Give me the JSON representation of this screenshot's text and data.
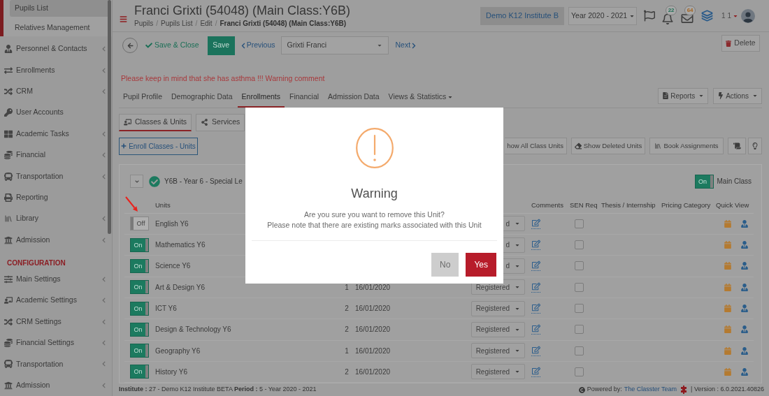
{
  "sidebar": {
    "subitems": [
      {
        "label": "Pupils List",
        "selected": true
      },
      {
        "label": "Relatives Management",
        "selected": false
      }
    ],
    "items": [
      {
        "label": "Personnel & Contacts",
        "expandable": true
      },
      {
        "label": "Enrollments",
        "expandable": true
      },
      {
        "label": "CRM",
        "expandable": true
      },
      {
        "label": "User Accounts",
        "expandable": false
      },
      {
        "label": "Academic Tasks",
        "expandable": true
      },
      {
        "label": "Financial",
        "expandable": true
      },
      {
        "label": "Transportation",
        "expandable": true
      },
      {
        "label": "Reporting",
        "expandable": false
      },
      {
        "label": "Library",
        "expandable": true
      },
      {
        "label": "Admission",
        "expandable": true
      }
    ],
    "section_title": "CONFIGURATION",
    "config_items": [
      {
        "label": "Main Settings",
        "expandable": true
      },
      {
        "label": "Academic Settings",
        "expandable": true
      },
      {
        "label": "CRM Settings",
        "expandable": true
      },
      {
        "label": "Financial Settings",
        "expandable": true
      },
      {
        "label": "Transportation",
        "expandable": true
      },
      {
        "label": "Admission",
        "expandable": true
      }
    ]
  },
  "header": {
    "title": "Franci Grixti (54048) (Main Class:Y6B)",
    "breadcrumb": [
      {
        "label": "Pupils",
        "separator": "/",
        "current": false
      },
      {
        "label": "Pupils List",
        "separator": "/",
        "current": false
      },
      {
        "label": "Edit",
        "separator": "/",
        "current": false
      },
      {
        "label": "Franci Grixti (54048) (Main Class:Y6B)",
        "current": true
      }
    ],
    "institute": "Demo K12 Institute B",
    "year": "Year 2020 - 2021",
    "notifications": "22",
    "messages": "64",
    "user": "1 1"
  },
  "toolbar": {
    "save_close": "Save & Close",
    "save": "Save",
    "previous": "Previous",
    "pupil": "Grixti Franci",
    "next": "Next",
    "delete": "Delete"
  },
  "warning_comment": "Please keep in mind that she has asthma !!! Warning comment",
  "tabs": [
    {
      "label": "Pupil Profile",
      "selected": false,
      "menu": false
    },
    {
      "label": "Demographic Data",
      "selected": false,
      "menu": false
    },
    {
      "label": "Enrollments",
      "selected": true,
      "menu": false
    },
    {
      "label": "Financial",
      "selected": false,
      "menu": false
    },
    {
      "label": "Admission Data",
      "selected": false,
      "menu": false
    },
    {
      "label": "Views & Statistics",
      "selected": false,
      "menu": true
    }
  ],
  "tab_actions": [
    "Reports",
    "Actions"
  ],
  "subtabs": [
    {
      "label": "Classes & Units",
      "selected": true
    },
    {
      "label": "Services",
      "selected": false
    }
  ],
  "unit_actions": {
    "enroll": "Enroll Classes - Units",
    "buttons": [
      "how All Class Units",
      "Show Deleted Units",
      "Book Assignments"
    ]
  },
  "class_group": {
    "title": "Y6B - Year 6 - Special Le",
    "expanded": true,
    "main_class": {
      "switch_label": "On",
      "on": true,
      "label": "Main Class"
    }
  },
  "table": {
    "columns": [
      "Units",
      "Comments",
      "SEN Req",
      "Thesis / Internship",
      "Pricing Category",
      "Quick View"
    ],
    "rows": [
      {
        "switch_label": "Off",
        "on": false,
        "unit": "English Y6",
        "column_5": "d",
        "sen_req": false
      },
      {
        "switch_label": "On",
        "on": true,
        "unit": "Mathematics Y6",
        "column_5": "d",
        "sen_req": false
      },
      {
        "switch_label": "On",
        "on": true,
        "unit": "Science Y6",
        "column_5": "d",
        "sen_req": false
      },
      {
        "switch_label": "On",
        "on": true,
        "unit": "Art & Design Y6",
        "column_3": "1",
        "column_4": "16/01/2020",
        "column_5": "Registered",
        "sen_req": false
      },
      {
        "switch_label": "On",
        "on": true,
        "unit": "ICT Y6",
        "column_3": "2",
        "column_4": "16/01/2020",
        "column_5": "Registered",
        "sen_req": false
      },
      {
        "switch_label": "On",
        "on": true,
        "unit": "Design & Technology Y6",
        "column_3": "2",
        "column_4": "16/01/2020",
        "column_5": "Registered",
        "sen_req": false
      },
      {
        "switch_label": "On",
        "on": true,
        "unit": "Geography Y6",
        "column_3": "1",
        "column_4": "16/01/2020",
        "column_5": "Registered",
        "sen_req": false
      },
      {
        "switch_label": "On",
        "on": true,
        "unit": "History Y6",
        "column_3": "2",
        "column_4": "16/01/2020",
        "column_5": "Registered",
        "sen_req": false
      }
    ]
  },
  "footer": {
    "info": "**Institute :** 27 - Demo K12 Institute BETA **Period :** 5 - Year 2020 - 2021",
    "powered_by": "Powered by:",
    "team_link": "The Classter Team",
    "version": "| Version : 6.0.2021.40826"
  },
  "modal": {
    "title": "Warning",
    "lines": [
      "Are you sure you want to remove this Unit?",
      "Please note that there are existing marks associated with this Unit"
    ],
    "buttons": [
      {
        "label": "No",
        "kind": "cancel"
      },
      {
        "label": "Yes",
        "kind": "confirm"
      }
    ]
  }
}
